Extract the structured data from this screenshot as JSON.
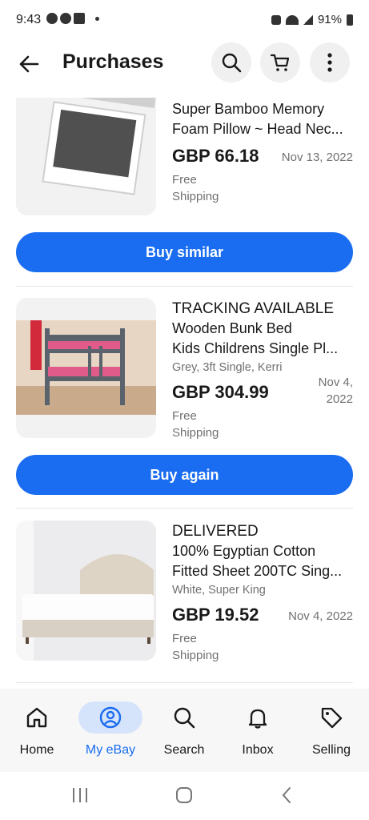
{
  "status_bar": {
    "time": "9:43",
    "battery": "91%"
  },
  "header": {
    "title": "Purchases",
    "back_icon": "back-arrow-icon",
    "actions": [
      "search-icon",
      "cart-icon",
      "more-vertical-icon"
    ]
  },
  "orders": [
    {
      "status": "",
      "title": "Super Bamboo Memory Foam Pillow ~ Head Nec...",
      "title_line1": "Super Bamboo Memory",
      "title_line2": "Foam Pillow ~ Head Nec...",
      "variant": "",
      "price": "GBP 66.18",
      "date": "Nov 13, 2022",
      "shipping": "Free Shipping",
      "action_label": "Buy similar"
    },
    {
      "status": "TRACKING AVAILABLE",
      "title_line1": "Wooden Bunk Bed",
      "title_line2": "Kids Childrens Single Pl...",
      "variant": "Grey, 3ft Single, Kerri",
      "price": "GBP 304.99",
      "date": "Nov 4, 2022",
      "shipping": "Free Shipping",
      "action_label": "Buy again"
    },
    {
      "status": "DELIVERED",
      "title_line1": "100% Egyptian Cotton",
      "title_line2": "Fitted Sheet 200TC Sing...",
      "variant": "White, Super King",
      "price": "GBP 19.52",
      "date": "Nov 4, 2022",
      "shipping": "Free Shipping"
    }
  ],
  "bottom_nav": [
    {
      "label": "Home",
      "icon": "home-icon",
      "active": false
    },
    {
      "label": "My eBay",
      "icon": "user-circle-icon",
      "active": true
    },
    {
      "label": "Search",
      "icon": "search-icon",
      "active": false
    },
    {
      "label": "Inbox",
      "icon": "bell-icon",
      "active": false
    },
    {
      "label": "Selling",
      "icon": "tag-icon",
      "active": false
    }
  ],
  "colors": {
    "accent": "#1a6df0",
    "active_nav_bg": "#d6e4fb",
    "text": "#191919",
    "muted": "#707070"
  }
}
